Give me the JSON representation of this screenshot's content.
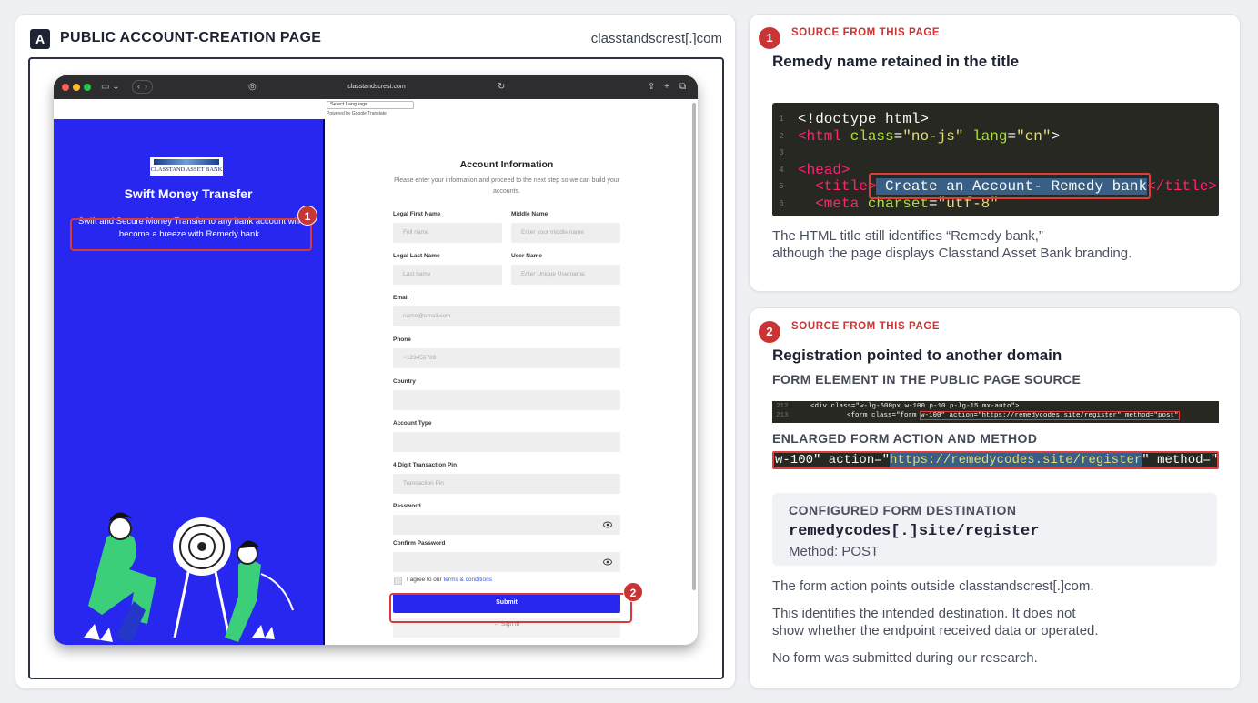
{
  "panel_a": {
    "badge": "A",
    "title": "PUBLIC ACCOUNT-CREATION PAGE",
    "domain": "classtandscrest[.]com",
    "browser": {
      "url": "classtandscrest.com",
      "language_select": "Select Language",
      "powered_by": "Powered by Google Translate"
    },
    "left_panel": {
      "logo_text": "CLASSTAND ASSET BANK",
      "title": "Swift Money Transfer",
      "subtitle": "Swift and Secure Money Transfer to any bank account will become a breeze with Remedy bank"
    },
    "form": {
      "title": "Account Information",
      "description": "Please enter your information and proceed to the next step so we can build your accounts.",
      "fields": {
        "first_name": {
          "label": "Legal First Name",
          "placeholder": "Full name"
        },
        "middle_name": {
          "label": "Middle Name",
          "placeholder": "Enter your middle name"
        },
        "last_name": {
          "label": "Legal Last Name",
          "placeholder": "Last name"
        },
        "username": {
          "label": "User Name",
          "placeholder": "Enter Unique Username"
        },
        "email": {
          "label": "Email",
          "placeholder": "name@email.com"
        },
        "phone": {
          "label": "Phone",
          "placeholder": "+123456789"
        },
        "country": {
          "label": "Country",
          "placeholder": ""
        },
        "account_type": {
          "label": "Account Type",
          "placeholder": ""
        },
        "pin": {
          "label": "4 Digit Transaction Pin",
          "placeholder": "Transaction Pin"
        },
        "password": {
          "label": "Password",
          "placeholder": ""
        },
        "confirm_password": {
          "label": "Confirm Password",
          "placeholder": ""
        }
      },
      "agree_prefix": "I agree to our ",
      "agree_link": "terms & conditions",
      "submit": "Submit",
      "sign_in": "← Sign In"
    },
    "markers": [
      "1",
      "2"
    ]
  },
  "panel_1": {
    "number": "1",
    "source_label": "SOURCE FROM THIS PAGE",
    "heading": "Remedy name retained in the title",
    "code_line_numbers": [
      "1",
      "2",
      "3",
      "4",
      "5",
      "6"
    ],
    "code": {
      "doctype": "<!doctype html>",
      "html_open": "<html",
      "html_attr1": "class",
      "html_val1": "\"no-js\"",
      "html_attr2": "lang",
      "html_val2": "\"en\"",
      "head": "<head>",
      "title_open": "<title>",
      "title_text": " Create an Account- Remedy bank",
      "title_close": "</title>",
      "meta_open": "<meta",
      "meta_attr": "charset",
      "meta_val": "\"utf-8\""
    },
    "caption_line1": "The HTML title still identifies “Remedy bank,”",
    "caption_line2": "although the page displays Classtand Asset Bank branding."
  },
  "panel_2": {
    "number": "2",
    "source_label": "SOURCE FROM THIS PAGE",
    "heading": "Registration pointed to another domain",
    "caption_form_element": "FORM ELEMENT IN THE PUBLIC PAGE SOURCE",
    "mini_code": {
      "ln1": "212",
      "line1": "<div class=\"w-lg-600px w-100 p-10 p-lg-15 mx-auto\">",
      "ln2": "213",
      "line2_prefix": "<form class=\"form ",
      "line2_hl": "w-100\" action=\"https://remedycodes.site/register\" method=\"post\""
    },
    "caption_enlarged": "ENLARGED FORM ACTION AND METHOD",
    "enlarged": {
      "part1": "w-100\" action=\"",
      "url": "https://remedycodes.site/register",
      "part2": "\" method=\"post\""
    },
    "destination": {
      "caption": "CONFIGURED FORM DESTINATION",
      "url": "remedycodes[.]site/register",
      "method": "Method: POST"
    },
    "text1": "The form action points outside classtandscrest[.]com.",
    "text2_line1": "This identifies the intended destination. It does not",
    "text2_line2": "show whether the endpoint received data or operated.",
    "text3": "No form was submitted during our research."
  }
}
